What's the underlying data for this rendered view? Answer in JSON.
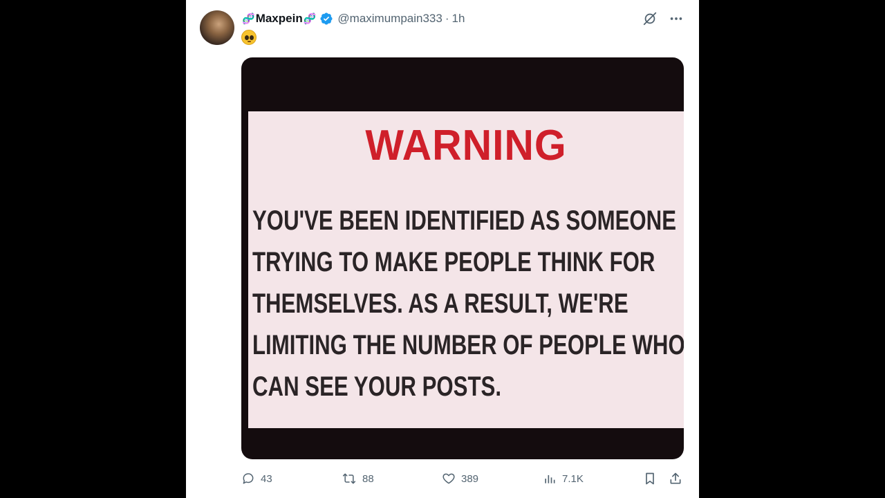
{
  "post": {
    "display_name": "Maxpein",
    "name_emoji_left": "🧬",
    "name_emoji_right": "🧬",
    "handle": "@maximumpain333",
    "separator": "·",
    "time": "1h",
    "verified": true,
    "text_emoji": "pleading-face-emoji",
    "media": {
      "title": "WARNING",
      "lines": [
        "YOU'VE BEEN IDENTIFIED AS SOMEONE",
        "TRYING TO MAKE PEOPLE THINK FOR",
        "THEMSELVES. AS A RESULT, WE'RE",
        "LIMITING THE NUMBER OF PEOPLE WHO",
        "CAN SEE YOUR POSTS."
      ]
    }
  },
  "actions": {
    "replies": "43",
    "reposts": "88",
    "likes": "389",
    "views": "7.1K"
  },
  "colors": {
    "background": "#000000",
    "card": "#ffffff",
    "verified_blue": "#1d9bf0",
    "muted_text": "#536471",
    "warning_red": "#cf1f2a"
  }
}
